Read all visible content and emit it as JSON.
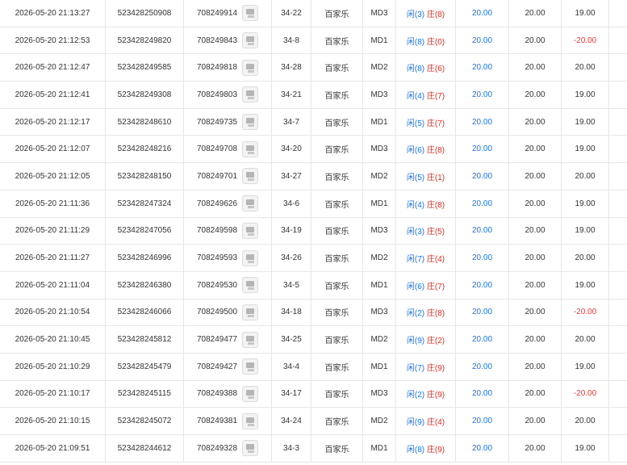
{
  "colors": {
    "player": "#1a73e8",
    "banker": "#d93025",
    "amount": "#1a73e8",
    "negative": "#e53935",
    "border": "#e6e6e6"
  },
  "icon_name": "game-record-icon",
  "rows": [
    {
      "time": "2026-05-20 21:13:27",
      "bet_id": "523428250908",
      "game_id": "708249914",
      "table": "34-22",
      "game": "百家乐",
      "mode": "MD3",
      "p_label": "闲",
      "p_val": "(3)",
      "b_label": "庄",
      "b_val": "(8)",
      "amount": "20.00",
      "valid": "20.00",
      "win": "19.00",
      "win_negative": false
    },
    {
      "time": "2026-05-20 21:12:53",
      "bet_id": "523428249820",
      "game_id": "708249843",
      "table": "34-8",
      "game": "百家乐",
      "mode": "MD1",
      "p_label": "闲",
      "p_val": "(8)",
      "b_label": "庄",
      "b_val": "(0)",
      "amount": "20.00",
      "valid": "20.00",
      "win": "-20.00",
      "win_negative": true
    },
    {
      "time": "2026-05-20 21:12:47",
      "bet_id": "523428249585",
      "game_id": "708249818",
      "table": "34-28",
      "game": "百家乐",
      "mode": "MD2",
      "p_label": "闲",
      "p_val": "(8)",
      "b_label": "庄",
      "b_val": "(6)",
      "amount": "20.00",
      "valid": "20.00",
      "win": "20.00",
      "win_negative": false
    },
    {
      "time": "2026-05-20 21:12:41",
      "bet_id": "523428249308",
      "game_id": "708249803",
      "table": "34-21",
      "game": "百家乐",
      "mode": "MD3",
      "p_label": "闲",
      "p_val": "(4)",
      "b_label": "庄",
      "b_val": "(7)",
      "amount": "20.00",
      "valid": "20.00",
      "win": "19.00",
      "win_negative": false
    },
    {
      "time": "2026-05-20 21:12:17",
      "bet_id": "523428248610",
      "game_id": "708249735",
      "table": "34-7",
      "game": "百家乐",
      "mode": "MD1",
      "p_label": "闲",
      "p_val": "(5)",
      "b_label": "庄",
      "b_val": "(7)",
      "amount": "20.00",
      "valid": "20.00",
      "win": "19.00",
      "win_negative": false
    },
    {
      "time": "2026-05-20 21:12:07",
      "bet_id": "523428248216",
      "game_id": "708249708",
      "table": "34-20",
      "game": "百家乐",
      "mode": "MD3",
      "p_label": "闲",
      "p_val": "(6)",
      "b_label": "庄",
      "b_val": "(8)",
      "amount": "20.00",
      "valid": "20.00",
      "win": "19.00",
      "win_negative": false
    },
    {
      "time": "2026-05-20 21:12:05",
      "bet_id": "523428248150",
      "game_id": "708249701",
      "table": "34-27",
      "game": "百家乐",
      "mode": "MD2",
      "p_label": "闲",
      "p_val": "(5)",
      "b_label": "庄",
      "b_val": "(1)",
      "amount": "20.00",
      "valid": "20.00",
      "win": "20.00",
      "win_negative": false
    },
    {
      "time": "2026-05-20 21:11:36",
      "bet_id": "523428247324",
      "game_id": "708249626",
      "table": "34-6",
      "game": "百家乐",
      "mode": "MD1",
      "p_label": "闲",
      "p_val": "(4)",
      "b_label": "庄",
      "b_val": "(8)",
      "amount": "20.00",
      "valid": "20.00",
      "win": "19.00",
      "win_negative": false
    },
    {
      "time": "2026-05-20 21:11:29",
      "bet_id": "523428247056",
      "game_id": "708249598",
      "table": "34-19",
      "game": "百家乐",
      "mode": "MD3",
      "p_label": "闲",
      "p_val": "(3)",
      "b_label": "庄",
      "b_val": "(5)",
      "amount": "20.00",
      "valid": "20.00",
      "win": "19.00",
      "win_negative": false
    },
    {
      "time": "2026-05-20 21:11:27",
      "bet_id": "523428246996",
      "game_id": "708249593",
      "table": "34-26",
      "game": "百家乐",
      "mode": "MD2",
      "p_label": "闲",
      "p_val": "(7)",
      "b_label": "庄",
      "b_val": "(4)",
      "amount": "20.00",
      "valid": "20.00",
      "win": "20.00",
      "win_negative": false
    },
    {
      "time": "2026-05-20 21:11:04",
      "bet_id": "523428246380",
      "game_id": "708249530",
      "table": "34-5",
      "game": "百家乐",
      "mode": "MD1",
      "p_label": "闲",
      "p_val": "(6)",
      "b_label": "庄",
      "b_val": "(7)",
      "amount": "20.00",
      "valid": "20.00",
      "win": "19.00",
      "win_negative": false
    },
    {
      "time": "2026-05-20 21:10:54",
      "bet_id": "523428246066",
      "game_id": "708249500",
      "table": "34-18",
      "game": "百家乐",
      "mode": "MD3",
      "p_label": "闲",
      "p_val": "(2)",
      "b_label": "庄",
      "b_val": "(8)",
      "amount": "20.00",
      "valid": "20.00",
      "win": "-20.00",
      "win_negative": true
    },
    {
      "time": "2026-05-20 21:10:45",
      "bet_id": "523428245812",
      "game_id": "708249477",
      "table": "34-25",
      "game": "百家乐",
      "mode": "MD2",
      "p_label": "闲",
      "p_val": "(9)",
      "b_label": "庄",
      "b_val": "(2)",
      "amount": "20.00",
      "valid": "20.00",
      "win": "20.00",
      "win_negative": false
    },
    {
      "time": "2026-05-20 21:10:29",
      "bet_id": "523428245479",
      "game_id": "708249427",
      "table": "34-4",
      "game": "百家乐",
      "mode": "MD1",
      "p_label": "闲",
      "p_val": "(7)",
      "b_label": "庄",
      "b_val": "(9)",
      "amount": "20.00",
      "valid": "20.00",
      "win": "19.00",
      "win_negative": false
    },
    {
      "time": "2026-05-20 21:10:17",
      "bet_id": "523428245115",
      "game_id": "708249388",
      "table": "34-17",
      "game": "百家乐",
      "mode": "MD3",
      "p_label": "闲",
      "p_val": "(2)",
      "b_label": "庄",
      "b_val": "(9)",
      "amount": "20.00",
      "valid": "20.00",
      "win": "-20.00",
      "win_negative": true
    },
    {
      "time": "2026-05-20 21:10:15",
      "bet_id": "523428245072",
      "game_id": "708249381",
      "table": "34-24",
      "game": "百家乐",
      "mode": "MD2",
      "p_label": "闲",
      "p_val": "(9)",
      "b_label": "庄",
      "b_val": "(4)",
      "amount": "20.00",
      "valid": "20.00",
      "win": "20.00",
      "win_negative": false
    },
    {
      "time": "2026-05-20 21:09:51",
      "bet_id": "523428244612",
      "game_id": "708249328",
      "table": "34-3",
      "game": "百家乐",
      "mode": "MD1",
      "p_label": "闲",
      "p_val": "(8)",
      "b_label": "庄",
      "b_val": "(9)",
      "amount": "20.00",
      "valid": "20.00",
      "win": "19.00",
      "win_negative": false
    }
  ]
}
